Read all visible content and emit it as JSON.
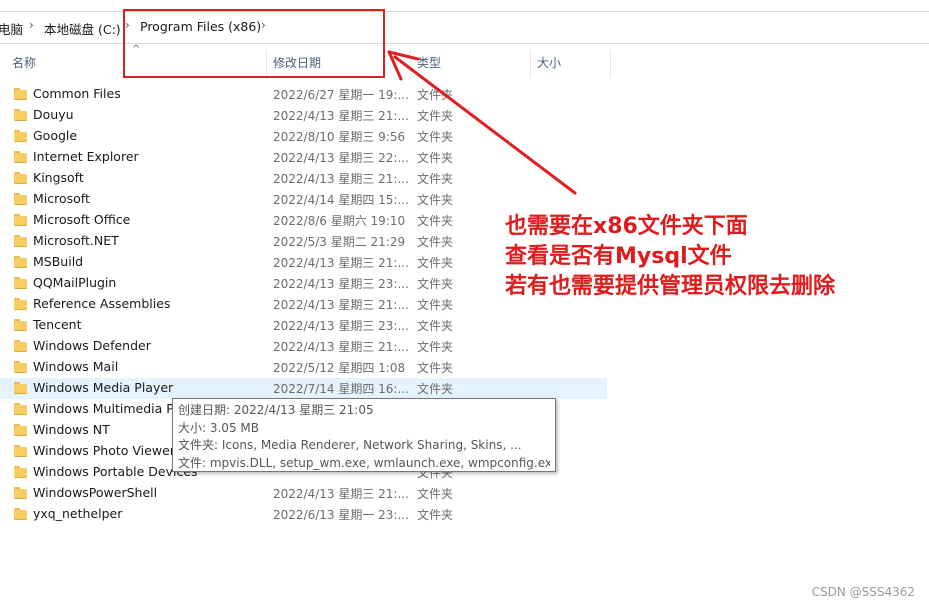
{
  "breadcrumb": {
    "items": [
      "电脑",
      "本地磁盘 (C:)",
      "Program Files (x86)"
    ]
  },
  "columns": {
    "name": "名称",
    "date": "修改日期",
    "type": "类型",
    "size": "大小"
  },
  "rows": [
    {
      "name": "Common Files",
      "date": "2022/6/27 星期一 19:...",
      "type": "文件夹"
    },
    {
      "name": "Douyu",
      "date": "2022/4/13 星期三 21:...",
      "type": "文件夹"
    },
    {
      "name": "Google",
      "date": "2022/8/10 星期三 9:56",
      "type": "文件夹"
    },
    {
      "name": "Internet Explorer",
      "date": "2022/4/13 星期三 22:...",
      "type": "文件夹"
    },
    {
      "name": "Kingsoft",
      "date": "2022/4/13 星期三 21:...",
      "type": "文件夹"
    },
    {
      "name": "Microsoft",
      "date": "2022/4/14 星期四 15:...",
      "type": "文件夹"
    },
    {
      "name": "Microsoft Office",
      "date": "2022/8/6 星期六 19:10",
      "type": "文件夹"
    },
    {
      "name": "Microsoft.NET",
      "date": "2022/5/3 星期二 21:29",
      "type": "文件夹"
    },
    {
      "name": "MSBuild",
      "date": "2022/4/13 星期三 21:...",
      "type": "文件夹"
    },
    {
      "name": "QQMailPlugin",
      "date": "2022/4/13 星期三 23:...",
      "type": "文件夹"
    },
    {
      "name": "Reference Assemblies",
      "date": "2022/4/13 星期三 21:...",
      "type": "文件夹"
    },
    {
      "name": "Tencent",
      "date": "2022/4/13 星期三 23:...",
      "type": "文件夹"
    },
    {
      "name": "Windows Defender",
      "date": "2022/4/13 星期三 21:...",
      "type": "文件夹"
    },
    {
      "name": "Windows Mail",
      "date": "2022/5/12 星期四 1:08",
      "type": "文件夹"
    },
    {
      "name": "Windows Media Player",
      "date": "2022/7/14 星期四 16:...",
      "type": "文件夹",
      "highlighted": true
    },
    {
      "name": "Windows Multimedia Pla",
      "date": "",
      "type": ""
    },
    {
      "name": "Windows NT",
      "date": "",
      "type": ""
    },
    {
      "name": "Windows Photo Viewer",
      "date": "",
      "type": ""
    },
    {
      "name": "Windows Portable Devices",
      "date": "",
      "type": "文件夹"
    },
    {
      "name": "WindowsPowerShell",
      "date": "2022/4/13 星期三 21:...",
      "type": "文件夹"
    },
    {
      "name": "yxq_nethelper",
      "date": "2022/6/13 星期一 23:...",
      "type": "文件夹"
    }
  ],
  "tooltip": {
    "created": "创建日期: 2022/4/13 星期三 21:05",
    "size": "大小: 3.05 MB",
    "folders": "文件夹: Icons, Media Renderer, Network Sharing, Skins, ...",
    "files": "文件: mpvis.DLL, setup_wm.exe, wmlaunch.exe, wmpconfig.exe, ..."
  },
  "annotation": {
    "lines": [
      "也需要在x86文件夹下面",
      "查看是否有Mysql文件",
      "若有也需要提供管理员权限去删除"
    ],
    "color": "#e01b1b"
  },
  "watermark": "CSDN @SSS4362",
  "icons": {
    "folder": "folder-icon",
    "breadcrumb_separator": "chevron-right-icon",
    "sort": "sort-caret-icon"
  }
}
